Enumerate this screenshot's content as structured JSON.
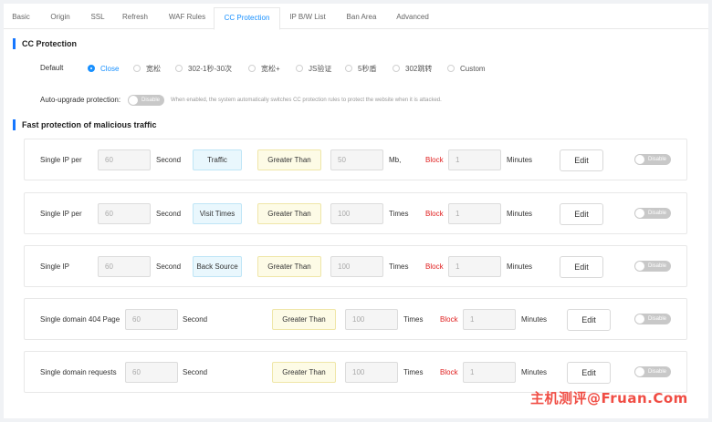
{
  "tabs": [
    "Basic",
    "Origin",
    "SSL",
    "Refresh",
    "WAF Rules",
    "CC Protection",
    "IP B/W List",
    "Ban Area",
    "Advanced"
  ],
  "active_tab": "CC Protection",
  "cc": {
    "title": "CC Protection",
    "default_label": "Default",
    "options": [
      "Close",
      "宽松",
      "302-1秒-30次",
      "宽松+",
      "JS验证",
      "5秒盾",
      "302跳转",
      "Custom"
    ],
    "selected": "Close",
    "auto_upgrade_label": "Auto-upgrade protection:",
    "auto_upgrade_state": "Disable",
    "auto_upgrade_hint": "When enabled, the system automatically switches CC protection rules to protect the website when it is attacked."
  },
  "fast": {
    "title": "Fast protection of malicious traffic",
    "rules": [
      {
        "label": "Single IP per",
        "period": "60",
        "unit": "Second",
        "metric": "Traffic",
        "op": "Greater Than",
        "threshold": "50",
        "threshold_unit": "Mb,",
        "action": "Block",
        "duration": "1",
        "duration_unit": "Minutes",
        "edit": "Edit",
        "state": "Disable"
      },
      {
        "label": "Single IP per",
        "period": "60",
        "unit": "Second",
        "metric": "Visit Times",
        "op": "Greater Than",
        "threshold": "100",
        "threshold_unit": "Times",
        "action": "Block",
        "duration": "1",
        "duration_unit": "Minutes",
        "edit": "Edit",
        "state": "Disable"
      },
      {
        "label": "Single IP",
        "period": "60",
        "unit": "Second",
        "metric": "Back Source",
        "op": "Greater Than",
        "threshold": "100",
        "threshold_unit": "Times",
        "action": "Block",
        "duration": "1",
        "duration_unit": "Minutes",
        "edit": "Edit",
        "state": "Disable"
      },
      {
        "label": "Single domain 404 Page",
        "period": "60",
        "unit": "Second",
        "metric": "",
        "op": "Greater Than",
        "threshold": "100",
        "threshold_unit": "Times",
        "action": "Block",
        "duration": "1",
        "duration_unit": "Minutes",
        "edit": "Edit",
        "state": "Disable"
      },
      {
        "label": "Single domain requests",
        "period": "60",
        "unit": "Second",
        "metric": "",
        "op": "Greater Than",
        "threshold": "100",
        "threshold_unit": "Times",
        "action": "Block",
        "duration": "1",
        "duration_unit": "Minutes",
        "edit": "Edit",
        "state": "Disable"
      }
    ]
  },
  "watermark": "主机测评@Fruan.Com",
  "colors": {
    "accent": "#1890ff",
    "block": "#e02020",
    "switch_off": "#c8c8c8"
  }
}
